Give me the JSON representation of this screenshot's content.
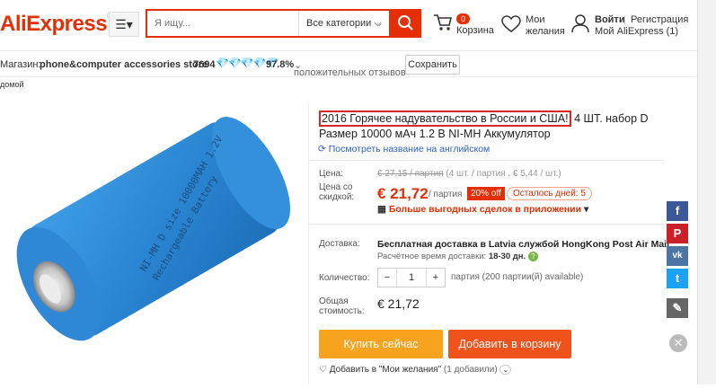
{
  "header": {
    "logo": "AliExpress",
    "search_placeholder": "Я ищу...",
    "category_select": "Все категории",
    "cart_count": "0",
    "cart_label": "Корзина",
    "wishlist_label_1": "Мои",
    "wishlist_label_2": "желания",
    "login": "Войти",
    "register": "Регистрация",
    "my_aliexpress": "Мой AliExpress (1)"
  },
  "store": {
    "label": "Магазин:",
    "name": "phone&computer accessories store",
    "score": "7694",
    "positive": "97.8%",
    "positive_label": "положительных отзывов",
    "save": "Сохранить"
  },
  "breadcrumb": "домой",
  "product": {
    "title_highlight": "2016 Горячее надувательство в России и США!",
    "title_rest": " 4 ШТ. набор D Размер 10000 мАч 1.2 В NI-MH Аккумулятор",
    "view_english": "Посмотреть название на английском",
    "price_label": "Цена:",
    "old_price": "€ 27,15 / партия",
    "old_price_note": "(4 шт. / партия , € 5,44 / шт.)",
    "discount_label_1": "Цена со",
    "discount_label_2": "скидкой:",
    "price": "€ 21,72",
    "price_unit": "/ партия",
    "off_badge": "20% off",
    "days_left": "Осталось дней: 5",
    "app_deals": "Больше выгодных сделок в приложении",
    "shipping_label": "Доставка:",
    "shipping_text": "Бесплатная доставка в Latvia службой HongKong Post Air Mail",
    "shipping_time_label": "Расчётное время доставки:",
    "shipping_time": "18-30 дн.",
    "quantity_label": "Количество:",
    "quantity_value": "1",
    "quantity_available": "партия (200 партии(й) available)",
    "total_label_1": "Общая",
    "total_label_2": "стоимость:",
    "total_price": "€ 21,72",
    "buy_now": "Купить сейчас",
    "add_to_cart": "Добавить в корзину",
    "add_wish": "Добавить в \"Мои желания\"",
    "wish_count": "(1 добавили)",
    "battery_text_1": "NI-MH D size 10000MAH 1.2V",
    "battery_text_2": "Rechargeable Battery"
  },
  "colors": {
    "brand": "#e62e04",
    "buy": "#f8a31e",
    "cart": "#f0521b"
  }
}
